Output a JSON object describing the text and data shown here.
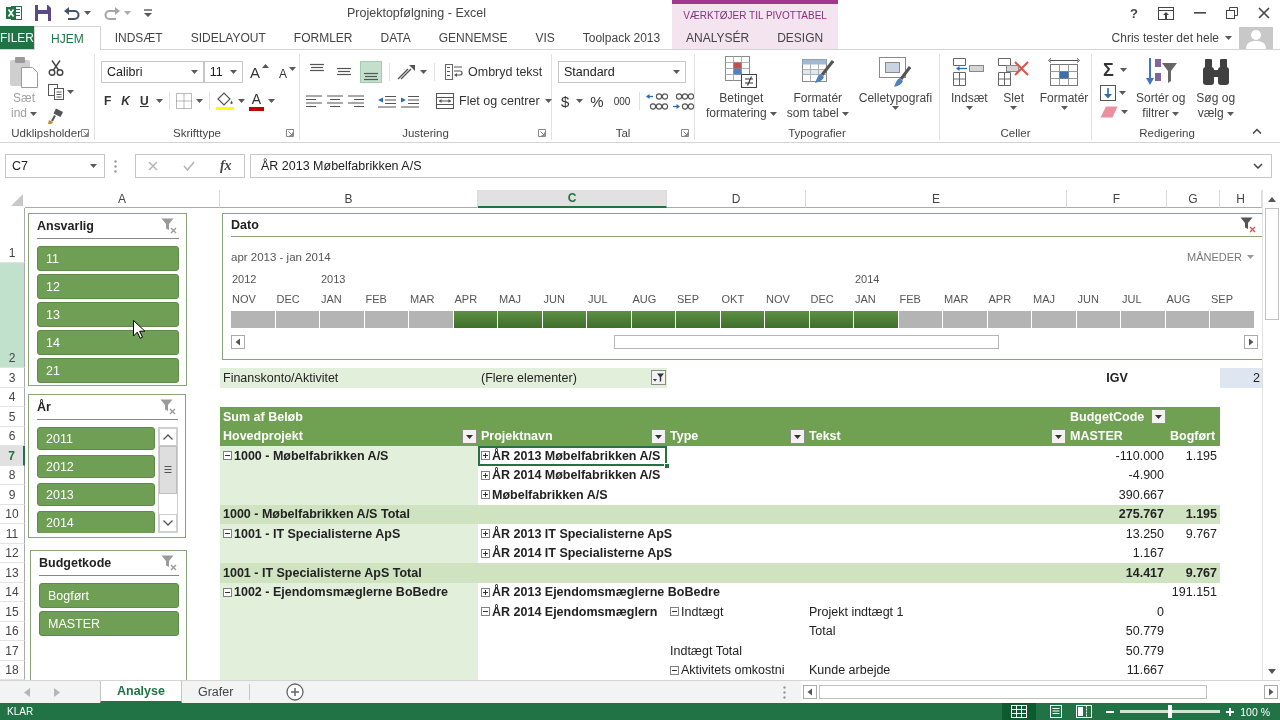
{
  "title_bar": {
    "title": "Projektopfølgning - Excel",
    "context_group": "VÆRKTØJER TIL PIVOTTABEL",
    "help": "?"
  },
  "ribbon_tabs": [
    {
      "label": "FILER",
      "kind": "file",
      "selected": false
    },
    {
      "label": "HJEM",
      "kind": "tab",
      "selected": true
    },
    {
      "label": "INDSÆT",
      "kind": "tab",
      "selected": false
    },
    {
      "label": "SIDELAYOUT",
      "kind": "tab",
      "selected": false
    },
    {
      "label": "FORMLER",
      "kind": "tab",
      "selected": false
    },
    {
      "label": "DATA",
      "kind": "tab",
      "selected": false
    },
    {
      "label": "GENNEMSE",
      "kind": "tab",
      "selected": false
    },
    {
      "label": "VIS",
      "kind": "tab",
      "selected": false
    },
    {
      "label": "Toolpack 2013",
      "kind": "tab",
      "selected": false
    },
    {
      "label": "ANALYSÉR",
      "kind": "context",
      "selected": false
    },
    {
      "label": "DESIGN",
      "kind": "context",
      "selected": false
    }
  ],
  "account": {
    "user": "Chris tester det hele"
  },
  "ribbon_groups": [
    {
      "kind": "clipboard",
      "label": "Udklipsholder",
      "launcher": true,
      "paste": {
        "lines": [
          "Sæt",
          "ind"
        ],
        "disabled": true
      }
    },
    {
      "kind": "font",
      "label": "Skrifttype",
      "launcher": true,
      "font_name": "Calibri",
      "font_size": "11",
      "grow": "A",
      "shrink": "A",
      "bold": "F",
      "italic": "K",
      "underline": "U",
      "font_color": "A"
    },
    {
      "kind": "alignment",
      "label": "Justering",
      "launcher": true,
      "vertical": [
        {
          "on": false
        },
        {
          "on": false
        },
        {
          "on": true
        }
      ],
      "wrap": "Ombryd tekst",
      "merge": "Flet og centrer"
    },
    {
      "kind": "number",
      "label": "Tal",
      "launcher": true,
      "format": "Standard",
      "currency": "$",
      "percent": "%",
      "thousands": "000"
    },
    {
      "kind": "styles",
      "label": "Typografier",
      "launcher": false,
      "buttons": [
        {
          "lines": [
            "Betinget",
            "formatering"
          ]
        },
        {
          "lines": [
            "Formatér",
            "som tabel"
          ]
        },
        {
          "lines": [
            "Celletypografi"
          ]
        }
      ]
    },
    {
      "kind": "cells",
      "label": "Celler",
      "launcher": false,
      "buttons": [
        {
          "lines": [
            "Indsæt"
          ]
        },
        {
          "lines": [
            "Slet"
          ]
        },
        {
          "lines": [
            "Formatér"
          ]
        }
      ]
    },
    {
      "kind": "editing",
      "label": "Redigering",
      "launcher": false,
      "sum": "Σ",
      "buttons": [
        {
          "lines": [
            "Sortér og",
            "filtrer"
          ]
        },
        {
          "lines": [
            "Søg og",
            "vælg"
          ]
        }
      ]
    }
  ],
  "formula_bar": {
    "name_box": "C7",
    "function_label": "fx",
    "formula": "ÅR 2013 Møbelfabrikken A/S"
  },
  "sheet": {
    "columns": [
      {
        "label": "A",
        "selected": false
      },
      {
        "label": "B",
        "selected": false
      },
      {
        "label": "C",
        "selected": true
      },
      {
        "label": "D",
        "selected": false
      },
      {
        "label": "E",
        "selected": false
      },
      {
        "label": "F",
        "selected": false
      },
      {
        "label": "G",
        "selected": false
      },
      {
        "label": "H",
        "selected": false
      }
    ],
    "rows": [
      {
        "label": "1",
        "selected": false,
        "highlighted": false
      },
      {
        "label": "2",
        "selected": false,
        "highlighted": true
      },
      {
        "label": "3",
        "selected": false,
        "highlighted": false
      },
      {
        "label": "4",
        "selected": false,
        "highlighted": false
      },
      {
        "label": "5",
        "selected": false,
        "highlighted": false
      },
      {
        "label": "6",
        "selected": false,
        "highlighted": false
      },
      {
        "label": "7",
        "selected": true,
        "highlighted": false
      },
      {
        "label": "8",
        "selected": false,
        "highlighted": false
      },
      {
        "label": "9",
        "selected": false,
        "highlighted": false
      },
      {
        "label": "10",
        "selected": false,
        "highlighted": false
      },
      {
        "label": "11",
        "selected": false,
        "highlighted": false
      },
      {
        "label": "12",
        "selected": false,
        "highlighted": false
      },
      {
        "label": "13",
        "selected": false,
        "highlighted": false
      },
      {
        "label": "14",
        "selected": false,
        "highlighted": false
      },
      {
        "label": "15",
        "selected": false,
        "highlighted": false
      },
      {
        "label": "16",
        "selected": false,
        "highlighted": false
      },
      {
        "label": "17",
        "selected": false,
        "highlighted": false
      },
      {
        "label": "18",
        "selected": false,
        "highlighted": false
      }
    ]
  },
  "slicers": [
    {
      "title": "Ansvarlig",
      "scrollbar": false,
      "items": [
        {
          "label": "11",
          "selected": true
        },
        {
          "label": "12",
          "selected": true
        },
        {
          "label": "13",
          "selected": true
        },
        {
          "label": "14",
          "selected": true
        },
        {
          "label": "21",
          "selected": true
        }
      ]
    },
    {
      "title": "År",
      "scrollbar": true,
      "items": [
        {
          "label": "2011",
          "selected": true
        },
        {
          "label": "2012",
          "selected": true
        },
        {
          "label": "2013",
          "selected": true
        },
        {
          "label": "2014",
          "selected": true
        }
      ]
    },
    {
      "title": "Budgetkode",
      "scrollbar": false,
      "items": [
        {
          "label": "Bogført",
          "selected": true
        },
        {
          "label": "MASTER",
          "selected": true
        }
      ]
    }
  ],
  "timeline": {
    "title": "Dato",
    "range": "apr 2013 - jan 2014",
    "unit": "MÅNEDER",
    "months": [
      {
        "label": "NOV",
        "year": "2012",
        "selected": false
      },
      {
        "label": "DEC",
        "selected": false
      },
      {
        "label": "JAN",
        "year": "2013",
        "selected": false
      },
      {
        "label": "FEB",
        "selected": false
      },
      {
        "label": "MAR",
        "selected": false
      },
      {
        "label": "APR",
        "selected": true
      },
      {
        "label": "MAJ",
        "selected": true
      },
      {
        "label": "JUN",
        "selected": true
      },
      {
        "label": "JUL",
        "selected": true
      },
      {
        "label": "AUG",
        "selected": true
      },
      {
        "label": "SEP",
        "selected": true
      },
      {
        "label": "OKT",
        "selected": true
      },
      {
        "label": "NOV",
        "selected": true
      },
      {
        "label": "DEC",
        "selected": true
      },
      {
        "label": "JAN",
        "year": "2014",
        "selected": true
      },
      {
        "label": "FEB",
        "selected": false
      },
      {
        "label": "MAR",
        "selected": false
      },
      {
        "label": "APR",
        "selected": false
      },
      {
        "label": "MAJ",
        "selected": false
      },
      {
        "label": "JUN",
        "selected": false
      },
      {
        "label": "JUL",
        "selected": false
      },
      {
        "label": "AUG",
        "selected": false
      },
      {
        "label": "SEP",
        "selected": false
      }
    ]
  },
  "report_filter": {
    "field": "Finanskonto/Aktivitet",
    "value": "(Flere elementer)"
  },
  "side_cells": [
    {
      "kind": "label",
      "text": "IGV"
    },
    {
      "kind": "value",
      "text": "2"
    }
  ],
  "pivot": {
    "value_field": "Sum af Beløb",
    "column_field": "BudgetCode",
    "headers": [
      {
        "label": "Hovedprojekt",
        "filter": true
      },
      {
        "label": "Projektnavn",
        "filter": true
      },
      {
        "label": "Type",
        "filter": true
      },
      {
        "label": "Tekst",
        "filter": true
      },
      {
        "label": "MASTER",
        "filter": false
      },
      {
        "label": "Bogført",
        "filter": false
      }
    ],
    "rows": [
      {
        "kind": "item",
        "hovedprojekt": {
          "text": "1000 - Møbelfabrikken A/S",
          "expanded": true
        },
        "projektnavn": {
          "text": "ÅR 2013 Møbelfabrikken A/S",
          "expanded": false,
          "selected": true
        },
        "master": "-110.000",
        "bogfort": "1.195"
      },
      {
        "kind": "item",
        "projektnavn": {
          "text": "ÅR 2014 Møbelfabrikken A/S",
          "expanded": false,
          "selected": false
        },
        "master": "-4.900"
      },
      {
        "kind": "item",
        "projektnavn": {
          "text": "Møbelfabrikken A/S",
          "expanded": false,
          "selected": false
        },
        "master": "390.667"
      },
      {
        "kind": "total",
        "hovedprojekt": {
          "text": "1000 - Møbelfabrikken A/S Total"
        },
        "master": "275.767",
        "bogfort": "1.195"
      },
      {
        "kind": "item",
        "hovedprojekt": {
          "text": "1001 - IT Specialisterne ApS",
          "expanded": true
        },
        "projektnavn": {
          "text": "ÅR 2013 IT Specialisterne ApS",
          "expanded": false,
          "selected": false
        },
        "master": "13.250",
        "bogfort": "9.767"
      },
      {
        "kind": "item",
        "projektnavn": {
          "text": "ÅR 2014 IT Specialisterne ApS",
          "expanded": false,
          "selected": false
        },
        "master": "1.167"
      },
      {
        "kind": "total",
        "hovedprojekt": {
          "text": "1001 - IT Specialisterne ApS Total"
        },
        "master": "14.417",
        "bogfort": "9.767"
      },
      {
        "kind": "item",
        "hovedprojekt": {
          "text": "1002 - Ejendomsmæglerne BoBedre",
          "expanded": true
        },
        "projektnavn": {
          "text": "ÅR 2013 Ejendomsmæglerne BoBedre",
          "expanded": false,
          "selected": false
        },
        "bogfort": "191.151"
      },
      {
        "kind": "item",
        "projektnavn": {
          "text": "ÅR 2014 Ejendomsmæglern",
          "expanded": true,
          "selected": false
        },
        "type": {
          "text": "Indtægt",
          "expanded": true
        },
        "tekst": {
          "text": "Projekt indtægt 1"
        },
        "master": "0"
      },
      {
        "kind": "item",
        "tekst": {
          "text": "Total"
        },
        "master": "50.779"
      },
      {
        "kind": "item",
        "type": {
          "text": "Indtægt Total"
        },
        "master": "50.779"
      },
      {
        "kind": "item",
        "type": {
          "text": "Aktivitets omkostni",
          "expanded": true
        },
        "tekst": {
          "text": "Kunde arbejde"
        },
        "master": "11.667"
      }
    ]
  },
  "sheet_tabs": [
    {
      "label": "Analyse",
      "selected": true
    },
    {
      "label": "Grafer",
      "selected": false
    }
  ],
  "status_bar": {
    "status": "KLAR",
    "views": [
      {
        "kind": "normal",
        "selected": true
      },
      {
        "kind": "layout",
        "selected": false
      },
      {
        "kind": "pagebreak",
        "selected": false
      }
    ],
    "zoom": {
      "level": 0.5,
      "reading": "100 %"
    }
  }
}
